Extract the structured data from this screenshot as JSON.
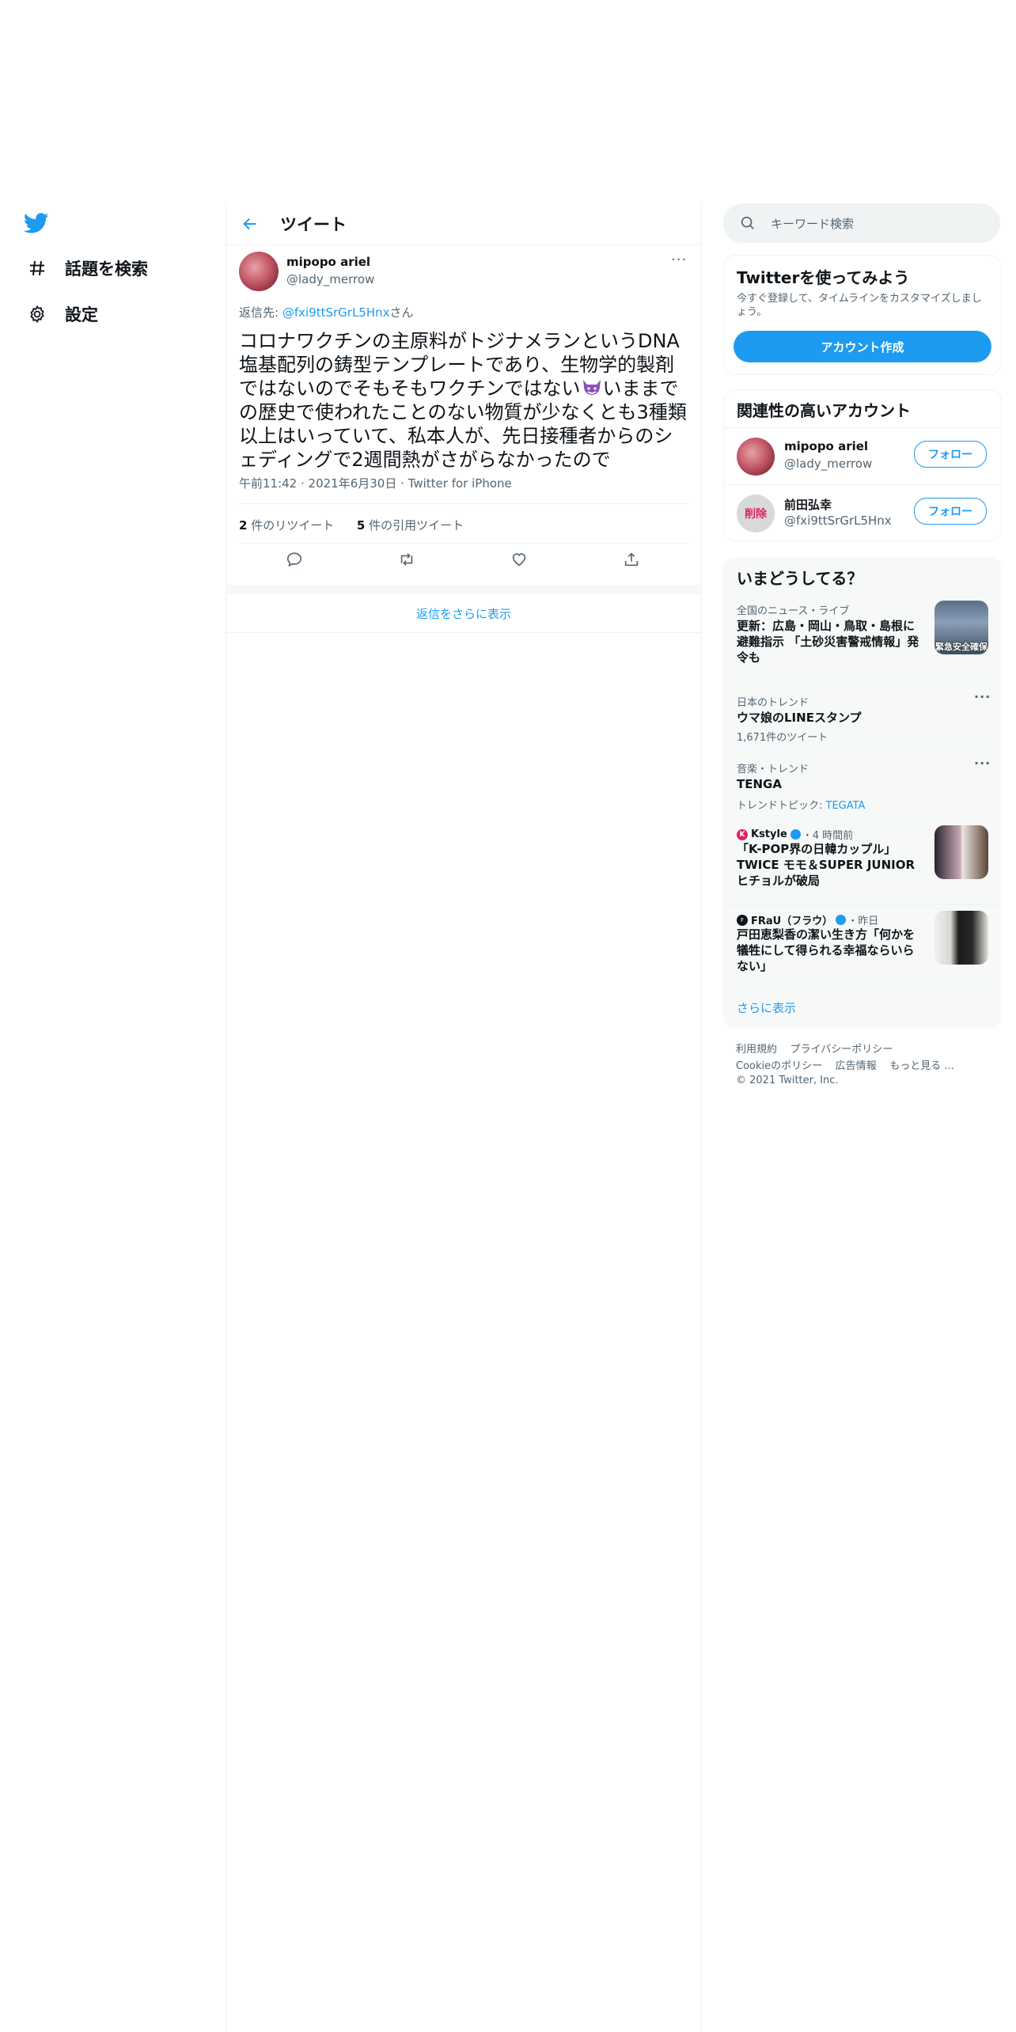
{
  "nav": {
    "items": [
      {
        "label": "話題を検索",
        "icon": "hashtag-icon"
      },
      {
        "label": "設定",
        "icon": "gear-icon"
      }
    ]
  },
  "header": {
    "title": "ツイート"
  },
  "tweet": {
    "name": "mipopo ariel",
    "handle": "@lady_merrow",
    "reply_prefix": "返信先: ",
    "reply_mention": "@fxi9ttSrGrL5Hnx",
    "reply_suffix": "さん",
    "body_before": "コロナワクチンの主原料がトジナメランというDNA塩基配列の鋳型テンプレートであり、生物学的製剤ではないのでそもそもワクチンではない",
    "body_after": "いままでの歴史で使われたことのない物質が少なくとも3種類以上はいっていて、私本人が、先日接種者からのシェディングで2週間熱がさがらなかったので",
    "time": "午前11:42",
    "date": "2021年6月30日",
    "source": "Twitter for iPhone",
    "retweet_count": "2",
    "retweet_label": "件のリツイート",
    "quote_count": "5",
    "quote_label": "件の引用ツイート",
    "more_menu": "···"
  },
  "more_replies": "返信をさらに表示",
  "search": {
    "placeholder": "キーワード検索"
  },
  "signup": {
    "title": "Twitterを使ってみよう",
    "desc": "今すぐ登録して、タイムラインをカスタマイズしましょう。",
    "button": "アカウント作成"
  },
  "related": {
    "title": "関連性の高いアカウント",
    "accounts": [
      {
        "name": "mipopo ariel",
        "handle": "@lady_merrow",
        "follow": "フォロー"
      },
      {
        "name": "前田弘幸",
        "handle": "@fxi9ttSrGrL5Hnx",
        "follow": "フォロー",
        "avatar_text": "削除"
      }
    ]
  },
  "trends": {
    "title": "いまどうしてる？",
    "items": [
      {
        "category": "全国のニュース・ライブ",
        "title": "更新：広島・岡山・鳥取・島根に避難指示 「土砂災害警戒情報」発令も",
        "thumb_text": "緊急安全確保"
      },
      {
        "category": "日本のトレンド",
        "title": "ウマ娘のLINEスタンプ",
        "sub": "1,671件のツイート"
      },
      {
        "category": "音楽・トレンド",
        "title": "TENGA",
        "sub_prefix": "トレンドトピック: ",
        "sub_link": "TEGATA"
      },
      {
        "source": "Kstyle",
        "time": "・4 時間前",
        "title": "「K-POP界の日韓カップル」TWICE モモ＆SUPER JUNIOR ヒチョルが破局"
      },
      {
        "source": "FRaU（フラウ）",
        "time": "・昨日",
        "title": "戸田恵梨香の潔い生き方「何かを犠牲にして得られる幸福ならいらない」"
      }
    ],
    "show_more": "さらに表示"
  },
  "footer": {
    "line1": [
      "利用規約",
      "プライバシーポリシー"
    ],
    "line2": [
      "Cookieのポリシー",
      "広告情報",
      "もっと見る ..."
    ],
    "copyright": "© 2021 Twitter, Inc."
  },
  "colors": {
    "accent": "#1d9bf0",
    "text": "#0f1419",
    "secondary": "#536471",
    "border": "#eff3f4"
  }
}
